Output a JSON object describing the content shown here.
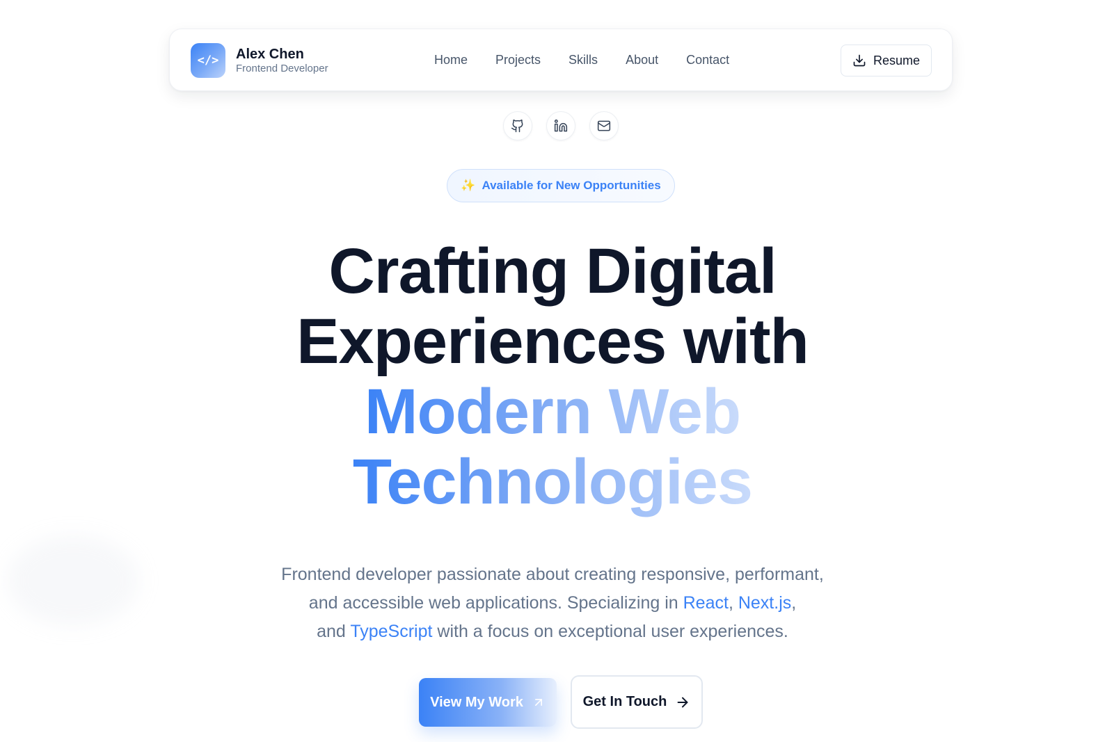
{
  "brand": {
    "name": "Alex Chen",
    "role": "Frontend Developer",
    "logo_icon": "code-icon",
    "logo_glyph": "</>"
  },
  "nav": {
    "links": [
      "Home",
      "Projects",
      "Skills",
      "About",
      "Contact"
    ],
    "resume_label": "Resume",
    "resume_icon": "download-icon"
  },
  "socials": [
    "github-icon",
    "linkedin-icon",
    "mail-icon"
  ],
  "badge": {
    "icon": "sparkles-icon",
    "label": "Available for New Opportunities"
  },
  "hero": {
    "line1": "Crafting Digital",
    "line2": "Experiences with",
    "line3": "Modern Web",
    "line4": "Technologies"
  },
  "description": {
    "part1": "Frontend developer passionate about creating responsive, performant,",
    "part2": "and accessible web applications. Specializing in",
    "tech1": "React",
    "sep1": ",",
    "tech2": "Next.js",
    "sep2": ",",
    "part3": "and",
    "tech3": "TypeScript",
    "part4": "with a focus on exceptional user experiences."
  },
  "cta": {
    "primary_label": "View My Work",
    "primary_icon": "arrow-up-right-icon",
    "secondary_label": "Get In Touch",
    "secondary_icon": "arrow-right-icon"
  },
  "colors": {
    "accent": "#3b82f6",
    "text_dark": "#0f172a",
    "text_muted": "#64748b"
  }
}
